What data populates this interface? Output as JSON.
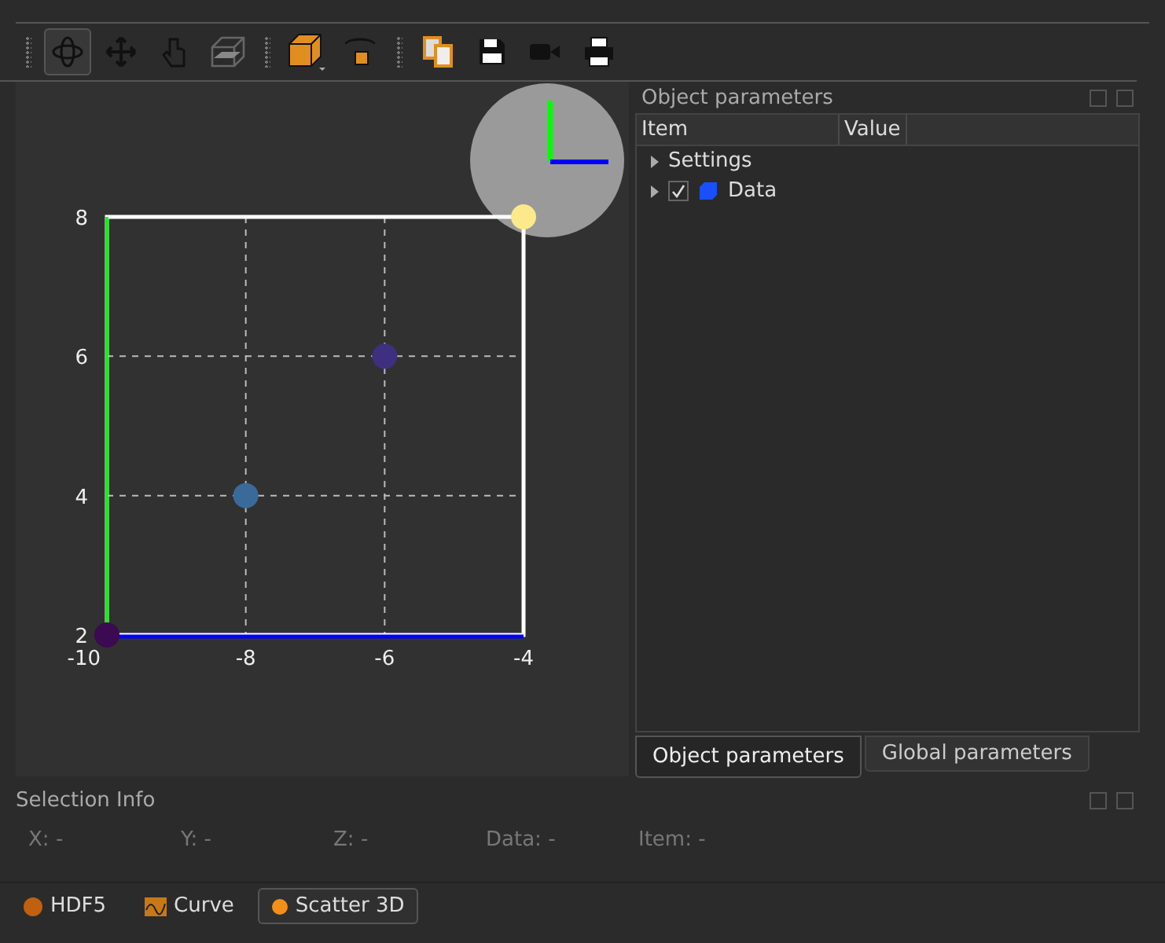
{
  "toolbar": {
    "groups": [
      [
        {
          "kind": "rotate",
          "selected": true
        },
        {
          "kind": "pan",
          "selected": false
        },
        {
          "kind": "hand",
          "selected": false
        },
        {
          "kind": "clip",
          "selected": false
        }
      ],
      [
        {
          "kind": "cube",
          "selected": false
        },
        {
          "kind": "orbit",
          "selected": false
        }
      ],
      [
        {
          "kind": "copy",
          "selected": false
        },
        {
          "kind": "save",
          "selected": false
        },
        {
          "kind": "video",
          "selected": false
        },
        {
          "kind": "print",
          "selected": false
        }
      ]
    ]
  },
  "plot": {
    "origin_label": "-10",
    "chart_data": {
      "type": "scatter",
      "grid": true,
      "x": [
        -10,
        -8,
        -6,
        -4
      ],
      "series": [
        {
          "values": [
            2,
            4,
            6,
            8
          ]
        }
      ],
      "xlim": [
        -10,
        -4
      ],
      "ylim": [
        2,
        8
      ],
      "xticks": [
        -8,
        -6,
        -4
      ],
      "yticks": [
        2,
        4,
        6,
        8
      ]
    }
  },
  "object_parameters": {
    "title": "Object parameters",
    "columns": [
      "Item",
      "Value"
    ],
    "items": [
      {
        "label": "Settings",
        "expanded": false
      },
      {
        "label": "Data",
        "expanded": false,
        "checked": true
      }
    ]
  },
  "panel_tabs": [
    {
      "label": "Object parameters",
      "selected": true
    },
    {
      "label": "Global parameters",
      "selected": false
    }
  ],
  "selection_info": {
    "title": "Selection Info",
    "fields": [
      {
        "label": "X:",
        "value": "-"
      },
      {
        "label": "Y:",
        "value": "-"
      },
      {
        "label": "Z:",
        "value": "-"
      },
      {
        "label": "Data:",
        "value": "-"
      },
      {
        "label": "Item:",
        "value": "-"
      }
    ]
  },
  "bottom_tabs": [
    {
      "label": "HDF5",
      "kind": "hdf5",
      "selected": false
    },
    {
      "label": "Curve",
      "kind": "curve",
      "selected": false
    },
    {
      "label": "Scatter 3D",
      "kind": "scatter",
      "selected": true
    }
  ]
}
